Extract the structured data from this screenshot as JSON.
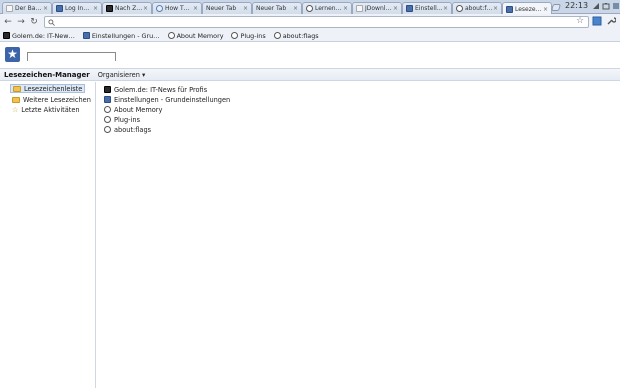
{
  "tabs": [
    {
      "title": "Der Ba…",
      "icon": "page-icon"
    },
    {
      "title": "Log In…",
      "icon": "facebook-icon"
    },
    {
      "title": "Nach Z…",
      "icon": "golem-icon"
    },
    {
      "title": "How T…",
      "icon": "globe-icon"
    },
    {
      "title": "Neuer Tab",
      "icon": "blank-icon"
    },
    {
      "title": "Neuer Tab",
      "icon": "blank-icon"
    },
    {
      "title": "Lernen…",
      "icon": "globe-icon"
    },
    {
      "title": "JDownl…",
      "icon": "page-icon"
    },
    {
      "title": "Einstell…",
      "icon": "settings-icon"
    },
    {
      "title": "about:f…",
      "icon": "globe-icon"
    },
    {
      "title": "Leseze…",
      "icon": "bookmark-icon",
      "active": true
    }
  ],
  "clock": "22:13",
  "omnibox": {
    "value": "",
    "placeholder": ""
  },
  "bookmarks_bar": [
    {
      "label": "Golem.de: IT-New…",
      "icon": "golem-icon"
    },
    {
      "label": "Einstellungen - Gru…",
      "icon": "settings-icon"
    },
    {
      "label": "About Memory",
      "icon": "globe-icon"
    },
    {
      "label": "Plug-ins",
      "icon": "globe-icon"
    },
    {
      "label": "about:flags",
      "icon": "globe-icon"
    }
  ],
  "manager": {
    "title": "Lesezeichen-Manager",
    "organize": "Organisieren ▾",
    "search_placeholder": ""
  },
  "tree": [
    {
      "label": "Lesezeichenleiste",
      "icon": "folder-icon",
      "selected": true
    },
    {
      "label": "Weitere Lesezeichen",
      "icon": "folder-icon"
    },
    {
      "label": "Letzte Aktivitäten",
      "icon": "star-icon"
    }
  ],
  "list": [
    {
      "label": "Golem.de: IT-News für Profis",
      "icon": "golem-icon"
    },
    {
      "label": "Einstellungen - Grundeinstellungen",
      "icon": "settings-icon"
    },
    {
      "label": "About Memory",
      "icon": "globe-icon"
    },
    {
      "label": "Plug-ins",
      "icon": "globe-icon"
    },
    {
      "label": "about:flags",
      "icon": "globe-icon"
    }
  ],
  "colors": {
    "accent": "#3c64a8",
    "folder": "#f2c24f",
    "selection": "#dde8f7"
  }
}
